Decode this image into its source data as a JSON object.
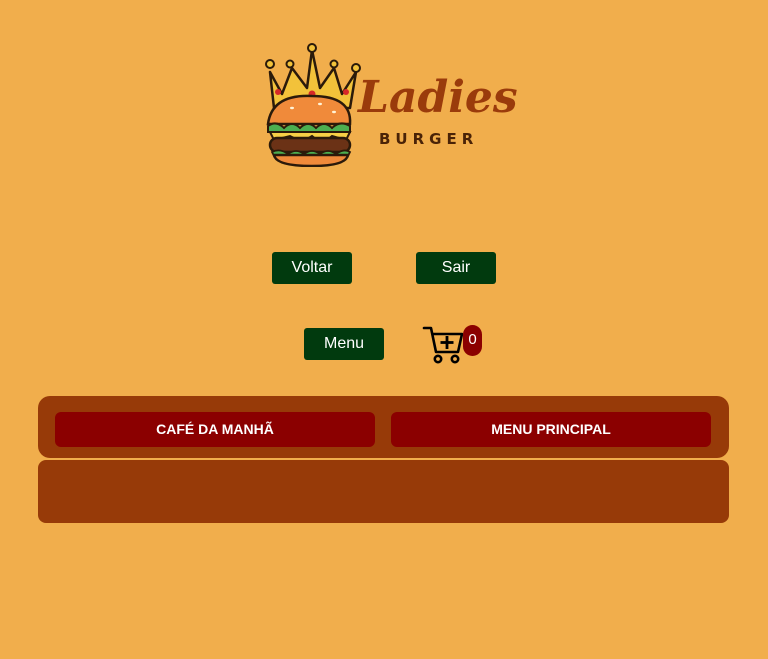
{
  "logo": {
    "title": "Ladies",
    "subtitle": "BURGER"
  },
  "nav": {
    "back_label": "Voltar",
    "exit_label": "Sair",
    "menu_label": "Menu"
  },
  "cart": {
    "count": "0",
    "icon": "cart-plus-icon"
  },
  "categories": [
    {
      "label": "CAFÉ DA MANHÃ"
    },
    {
      "label": "MENU PRINCIPAL"
    }
  ],
  "colors": {
    "background": "#f1ae4c",
    "dark_button": "#013a0e",
    "category_bar": "#973a08",
    "category_button": "#8b0000"
  }
}
